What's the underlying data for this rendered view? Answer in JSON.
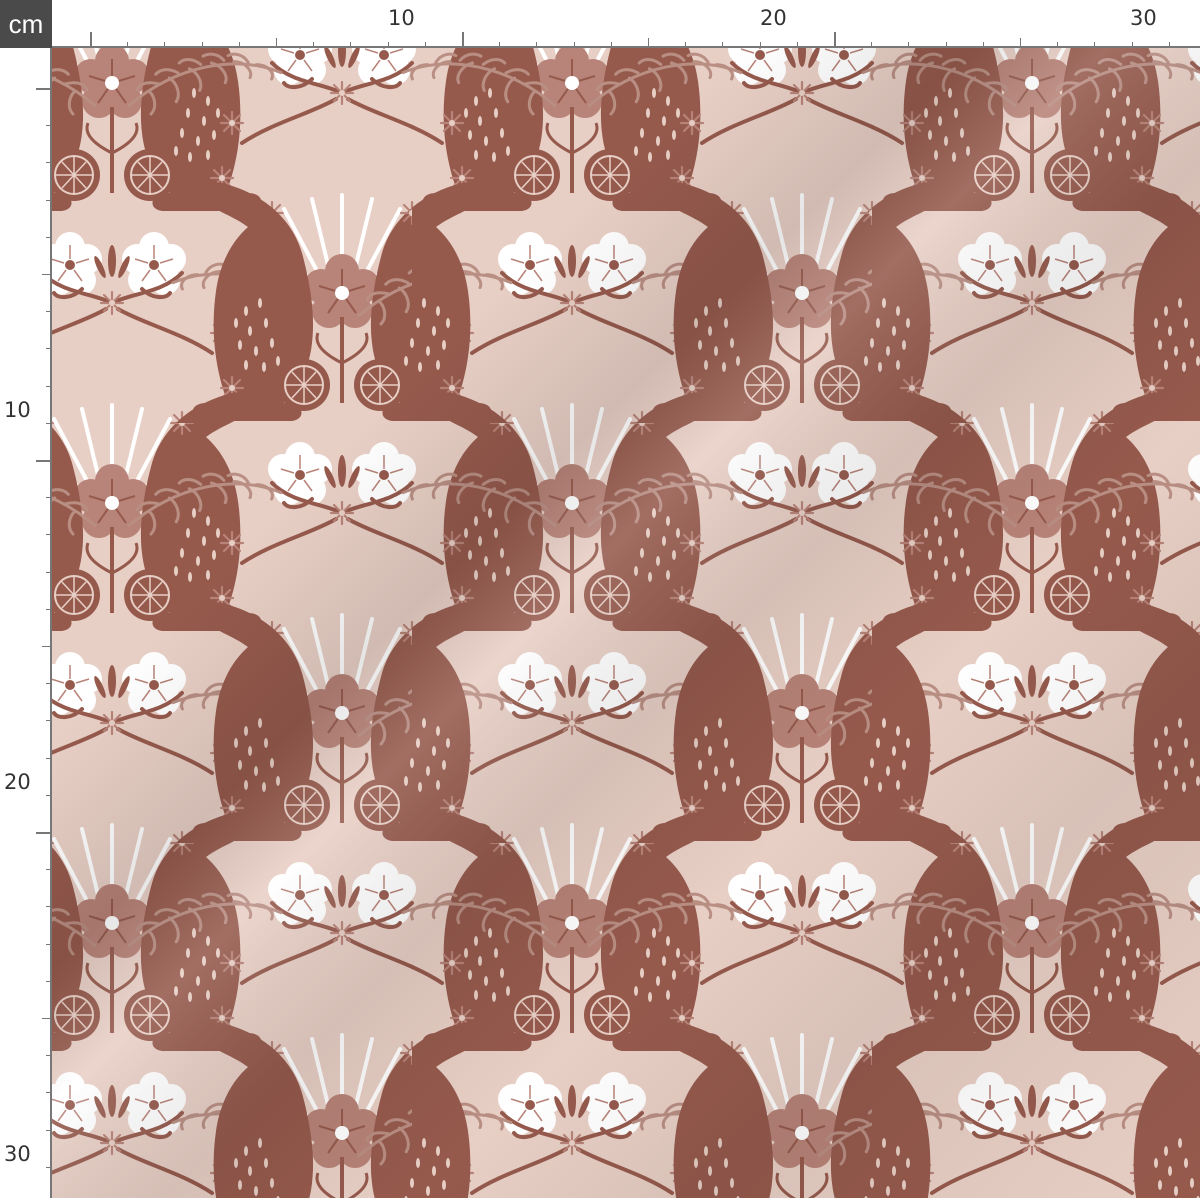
{
  "ruler": {
    "unit": "cm",
    "top_labels": [
      "10",
      "20",
      "30"
    ],
    "left_labels": [
      "10",
      "20",
      "30"
    ]
  },
  "fabric": {
    "motif": "folk-art bunnies with flowers",
    "colors": {
      "background": "#e8cfc5",
      "bunny": "#965a4d",
      "flower_pink": "#b88378",
      "flower_white": "#ffffff",
      "leaf": "#b98e83"
    }
  }
}
